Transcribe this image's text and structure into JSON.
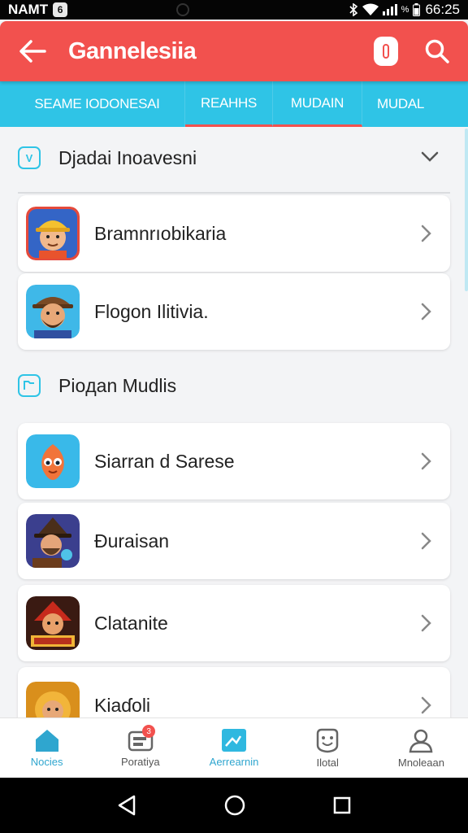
{
  "status_bar": {
    "carrier": "NAMT",
    "notification": "6",
    "time": "66:25",
    "battery_text": "%"
  },
  "header": {
    "title": "Gannelesiia",
    "back_icon": "arrow-left-icon",
    "pill_icon": "capsule-icon",
    "search_icon": "search-icon",
    "color": "#f2514e"
  },
  "tabs": [
    {
      "label": "SEAME IODONESAI",
      "active": false
    },
    {
      "label": "REAHHS",
      "active": true
    },
    {
      "label": "MUDAIN",
      "active": false
    },
    {
      "label": "MUDAL",
      "active": false
    }
  ],
  "tabs_color": "#2fc4e6",
  "sections": [
    {
      "title": "Djadai Inoavesni",
      "icon_letter": "V",
      "items": [
        {
          "label": "Bramnrıobikaria",
          "icon": "worker-helmet-avatar"
        },
        {
          "label": "Flogon Ilitivia.",
          "icon": "bearded-man-avatar"
        }
      ]
    },
    {
      "title": "Pioдan Mudlis",
      "items": [
        {
          "label": "Siarran d Sarese",
          "icon": "orange-fish-avatar"
        },
        {
          "label": "Ɖuraisan",
          "icon": "wizard-avatar"
        },
        {
          "label": "Clatanite",
          "icon": "red-warrior-avatar"
        },
        {
          "label": "Kiaɗoli",
          "icon": "golden-lion-avatar"
        }
      ]
    }
  ],
  "bottom_nav": [
    {
      "label": "Nocies",
      "icon": "home-icon",
      "active": true
    },
    {
      "label": "Poratiya",
      "icon": "chat-icon",
      "badge": "3",
      "active": false
    },
    {
      "label": "Aerrearnin",
      "icon": "image-icon",
      "active": true
    },
    {
      "label": "Ilotal",
      "icon": "smiley-icon",
      "active": false
    },
    {
      "label": "Mnoleaan",
      "icon": "person-icon",
      "active": false
    }
  ]
}
